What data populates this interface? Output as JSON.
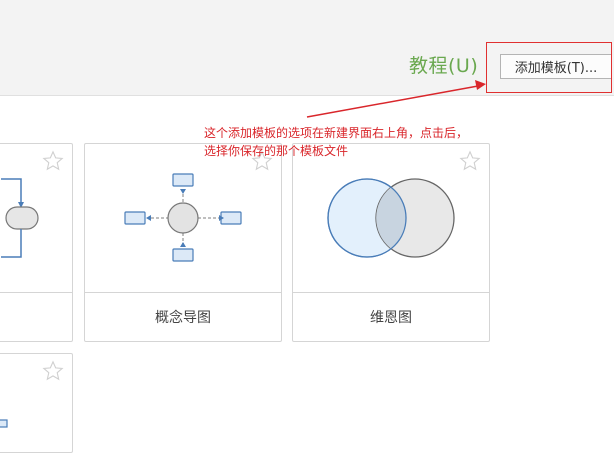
{
  "header": {
    "tutorial_label": "教程(U)",
    "add_template_label": "添加模板(T)..."
  },
  "annotation": {
    "text": "这个添加模板的选项在新建界面右上角，点击后，\n选择你保存的那个模板文件"
  },
  "cards": [
    {
      "label": ""
    },
    {
      "label": "概念导图"
    },
    {
      "label": "维恩图"
    },
    {
      "label": ""
    }
  ],
  "colors": {
    "accent_green": "#6aa84f",
    "annotation_red": "#d9262b",
    "diagram_blue": "#4a7db8"
  }
}
